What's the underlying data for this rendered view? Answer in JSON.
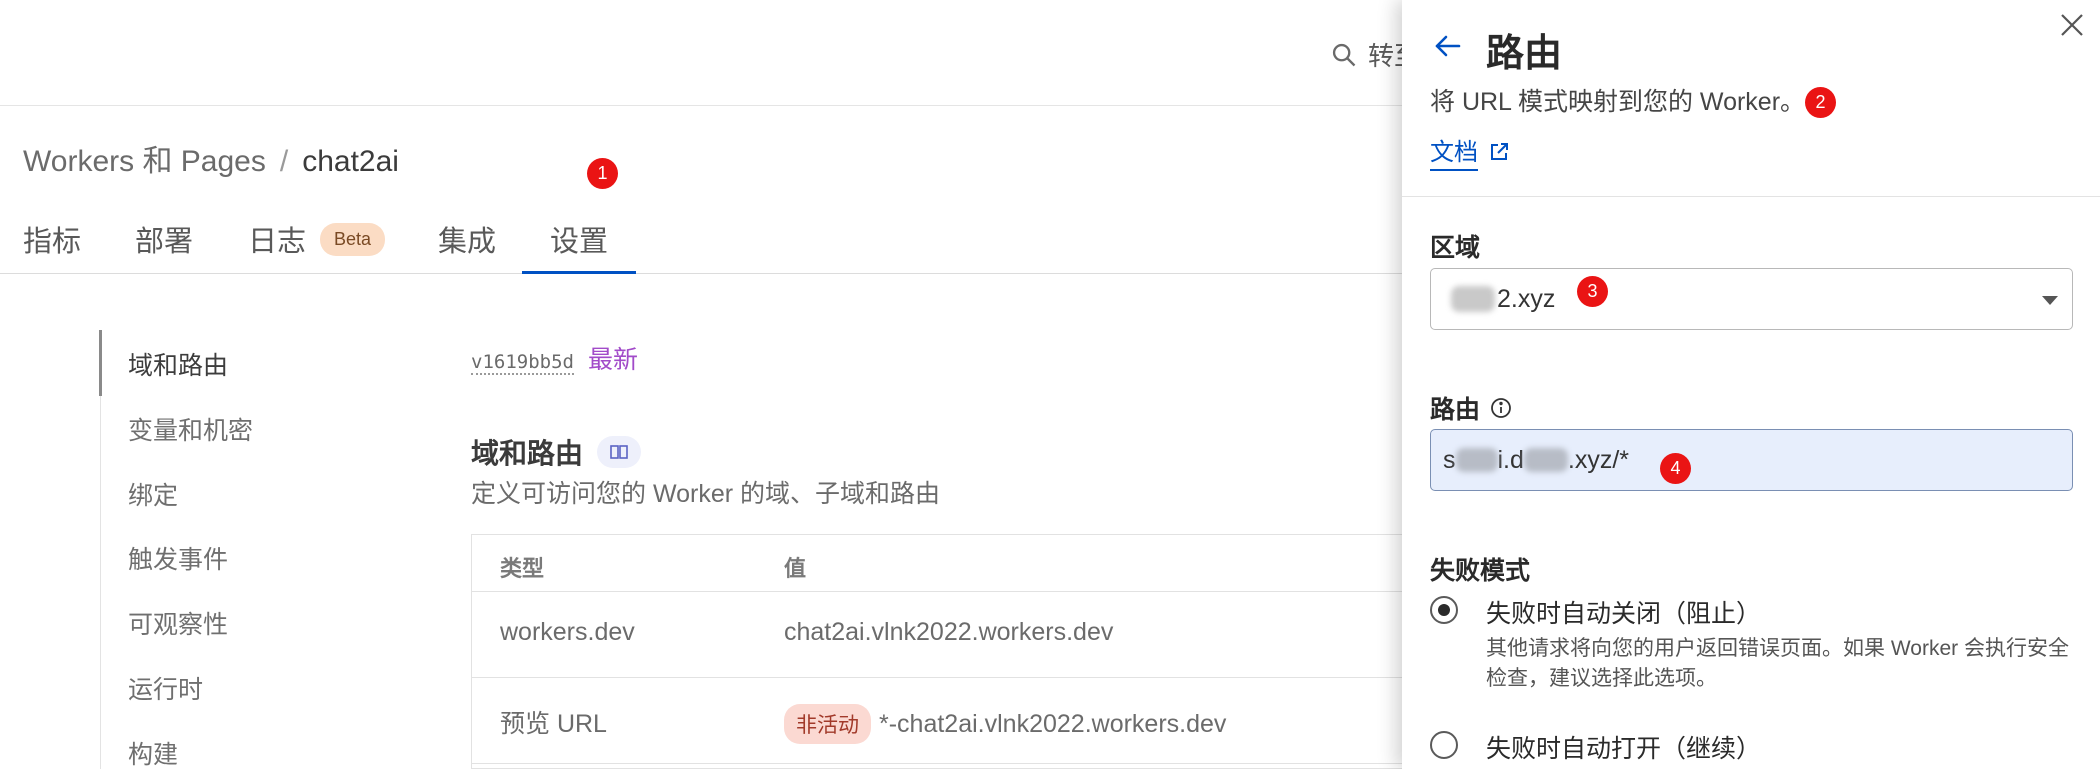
{
  "top_search": {
    "icon": "search-icon",
    "text": "转至"
  },
  "breadcrumb": {
    "root": "Workers 和 Pages",
    "separator": "/",
    "current": "chat2ai"
  },
  "tabs": [
    {
      "label": "指标"
    },
    {
      "label": "部署"
    },
    {
      "label": "日志",
      "badge": "Beta"
    },
    {
      "label": "集成"
    },
    {
      "label": "设置",
      "active": true
    }
  ],
  "sidebar": {
    "items": [
      {
        "label": "域和路由",
        "active": true
      },
      {
        "label": "变量和机密"
      },
      {
        "label": "绑定"
      },
      {
        "label": "触发事件"
      },
      {
        "label": "可观察性"
      },
      {
        "label": "运行时"
      },
      {
        "label": "构建"
      }
    ]
  },
  "version": {
    "hash": "v1619bb5d",
    "tag": "最新"
  },
  "section": {
    "title": "域和路由",
    "description": "定义可访问您的 Worker 的域、子域和路由",
    "table": {
      "headers": [
        "类型",
        "值"
      ],
      "rows": [
        {
          "type": "workers.dev",
          "status": "",
          "value": "chat2ai.vlnk2022.workers.dev"
        },
        {
          "type": "预览 URL",
          "status": "非活动",
          "value": "*-chat2ai.vlnk2022.workers.dev"
        }
      ]
    }
  },
  "annotations": [
    "1",
    "2",
    "3",
    "4"
  ],
  "drawer": {
    "title": "路由",
    "subtitle": "将 URL 模式映射到您的 Worker。",
    "docs_link": "文档",
    "zone": {
      "label": "区域",
      "value": "2.xyz"
    },
    "route": {
      "label": "路由",
      "value_start": "s",
      "value_mid": "i.d",
      "value_end": ".xyz/*"
    },
    "failure_mode": {
      "label": "失败模式",
      "options": [
        {
          "label": "失败时自动关闭（阻止）",
          "selected": true,
          "description": "其他请求将向您的用户返回错误页面。如果 Worker 会执行安全检查，建议选择此选项。"
        },
        {
          "label": "失败时自动打开（继续）",
          "selected": false
        }
      ]
    }
  },
  "colors": {
    "accent": "#0051c3",
    "badge": "#ea1414",
    "latest": "#a24bc9"
  }
}
